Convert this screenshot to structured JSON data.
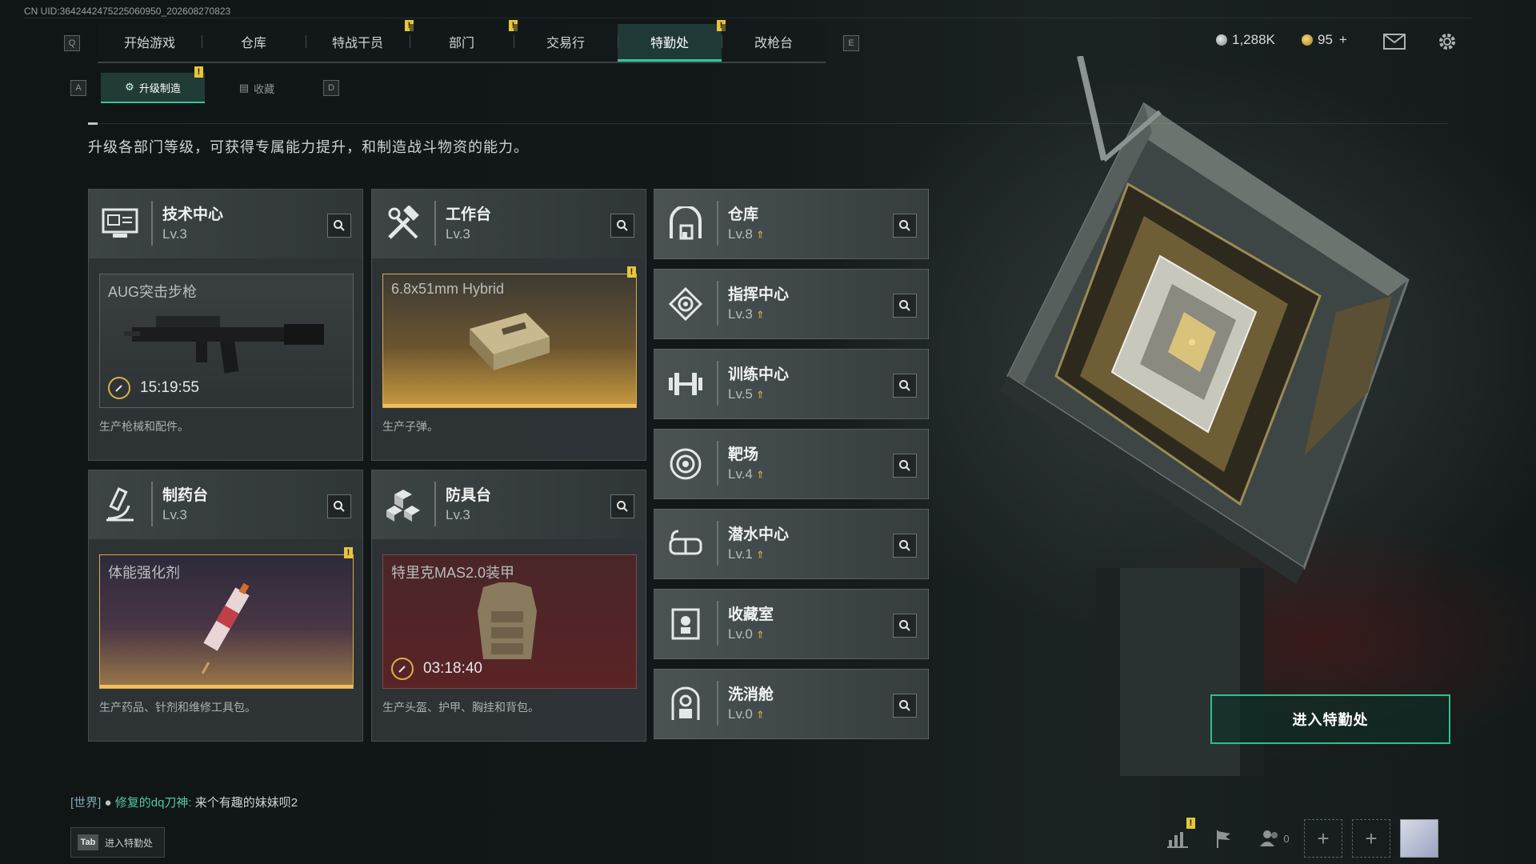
{
  "uid": "CN UID:3642442475225060950_202608270823",
  "nav": {
    "left_key": "Q",
    "right_key": "E",
    "tabs": [
      {
        "label": "开始游戏",
        "active": false,
        "badge": ""
      },
      {
        "label": "仓库",
        "active": false,
        "badge": ""
      },
      {
        "label": "特战干员",
        "active": false,
        "badge": "!"
      },
      {
        "label": "部门",
        "active": false,
        "badge": "!"
      },
      {
        "label": "交易行",
        "active": false,
        "badge": ""
      },
      {
        "label": "特勤处",
        "active": true,
        "badge": "!"
      },
      {
        "label": "改枪台",
        "active": false,
        "badge": ""
      }
    ]
  },
  "currency": {
    "silver": "1,288K",
    "gold": "95",
    "gold_add": "+"
  },
  "subnav": {
    "left_key": "A",
    "right_key": "D",
    "tabs": [
      {
        "label": "升级制造",
        "active": true,
        "badge": "!"
      },
      {
        "label": "收藏",
        "active": false,
        "badge": ""
      }
    ]
  },
  "description": "升级各部门等级，可获得专属能力提升，和制造战斗物资的能力。",
  "workshops": [
    {
      "name": "技术中心",
      "level": "Lv.3",
      "icon": "monitor-icon",
      "product": "AUG突击步枪",
      "timer": "15:19:55",
      "desc": "生产枪械和配件。",
      "badge": ""
    },
    {
      "name": "工作台",
      "level": "Lv.3",
      "icon": "tools-icon",
      "product": "6.8x51mm Hybrid",
      "timer": "",
      "desc": "生产子弹。",
      "badge": "!"
    },
    {
      "name": "制药台",
      "level": "Lv.3",
      "icon": "microscope-icon",
      "product": "体能强化剂",
      "timer": "",
      "desc": "生产药品、针剂和维修工具包。",
      "badge": "!"
    },
    {
      "name": "防具台",
      "level": "Lv.3",
      "icon": "blocks-icon",
      "product": "特里克MAS2.0装甲",
      "timer": "03:18:40",
      "desc": "生产头盔、护甲、胸挂和背包。",
      "badge": ""
    }
  ],
  "departments": [
    {
      "name": "仓库",
      "level": "Lv.8",
      "icon": "vault-icon"
    },
    {
      "name": "指挥中心",
      "level": "Lv.3",
      "icon": "command-icon"
    },
    {
      "name": "训练中心",
      "level": "Lv.5",
      "icon": "dumbbell-icon"
    },
    {
      "name": "靶场",
      "level": "Lv.4",
      "icon": "target-icon"
    },
    {
      "name": "潜水中心",
      "level": "Lv.1",
      "icon": "goggles-icon"
    },
    {
      "name": "收藏室",
      "level": "Lv.0",
      "icon": "display-case-icon"
    },
    {
      "name": "洗消舱",
      "level": "Lv.0",
      "icon": "hazmat-icon"
    }
  ],
  "enter_button": "进入特勤处",
  "chat": {
    "channel": "[世界]",
    "user": "修复的dq刀神:",
    "message": "来个有趣的妹妹呗2"
  },
  "tab_hint": {
    "key": "Tab",
    "label": "进入特勤处"
  },
  "friends_count": "0",
  "colors": {
    "accent": "#32c79c",
    "badge": "#e5c63a",
    "gold_product": "#c99a3e",
    "red_product": "#5a2326",
    "purple_product": "#3a2a3a"
  }
}
